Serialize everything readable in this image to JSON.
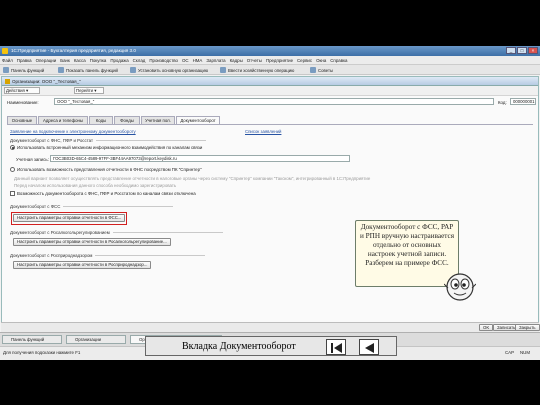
{
  "window": {
    "title": "1С:Предприятие - Бухгалтерия предприятия, редакция 3.0",
    "btn_min": "_",
    "btn_max": "□",
    "btn_close": "×"
  },
  "menu": [
    "Файл",
    "Правка",
    "Операции",
    "Банк",
    "Касса",
    "Покупка",
    "Продажа",
    "Склад",
    "Производство",
    "ОС",
    "НМА",
    "Зарплата",
    "Кадры",
    "Отчеты",
    "Предприятие",
    "Сервис",
    "Окна",
    "Справка"
  ],
  "toolbar": {
    "btn1": "Панель функций",
    "btn2": "Показать панель функций",
    "btn3": "Установить основную организацию",
    "btn4": "Ввести хозяйственную операцию",
    "btn5": "Советы"
  },
  "form": {
    "title": "Организации: ООО \"_Тестовая_\"",
    "actions_label": "Действия ▾",
    "go_label": "Перейти ▾",
    "name_label": "Наименование:",
    "name_value": "ООО \"_Тестовая_\"",
    "code_label": "Код:",
    "code_value": "000000001",
    "tabs": [
      "Основные",
      "Адреса и телефоны",
      "Коды",
      "Фонды",
      "Учетная пол.",
      "Документооборот"
    ],
    "enable_link": "Заявление на подключение к электронному документообороту",
    "applications_link": "Список заявлений",
    "section_fns": "Документооборот с ФНС, ПФР и Росстат",
    "radio_builtin": "Использовать встроенный механизм информационного взаимодействия по каналам связи",
    "account_label": "Учетная запись:",
    "account_value": "ГОС3B03D-65C4-4589-97FF-3BF44AA97073@report.keydisk.ru",
    "radio_spec": "Использовать возможность представления отчетности в ФНС посредством ПК \"Спринтер\"",
    "spec_note": "Данный вариант позволяет осуществлять представление отчетности в налоговые органы через систему \"Спринтер\" компании \"Такском\", интегрированный в 1С:Предприятие",
    "reg_note": "Перед началом использования данного способа необходимо зарегистрировать",
    "check_fns": "Возможность документооборота с ФНС, ПФР и Росстатом по каналам связи отключена",
    "section_fss": "Документооборот с ФСС",
    "fss_button": "Настроить параметры отправки отчетности в ФСС...",
    "section_rar": "Документооборот с Росалкогольрегулированием",
    "rar_button": "Настроить параметры отправки отчетности в Росалкогольрегулирование...",
    "section_rpn": "Документооборот с Росприроднадзором",
    "rpn_button": "Настроить параметры отправки отчетности в Росприроднадзор...",
    "ok_label": "OK",
    "write_label": "Записать",
    "close_label": "Закрыть"
  },
  "taskbar": {
    "tab1": "Панель функций",
    "tab2": "Организации",
    "tab3": "Организации: ООО \"_Тестовая_\""
  },
  "status": {
    "hint": "Для получения подсказки нажмите F1",
    "cap": "CAP",
    "num": "NUM"
  },
  "callout": "Документооборот с ФСС, РАР и РПН вручную настраивается отдельно от основных настроек учетной записи. Разберем на примере ФСС.",
  "caption": "Вкладка Документооборот"
}
